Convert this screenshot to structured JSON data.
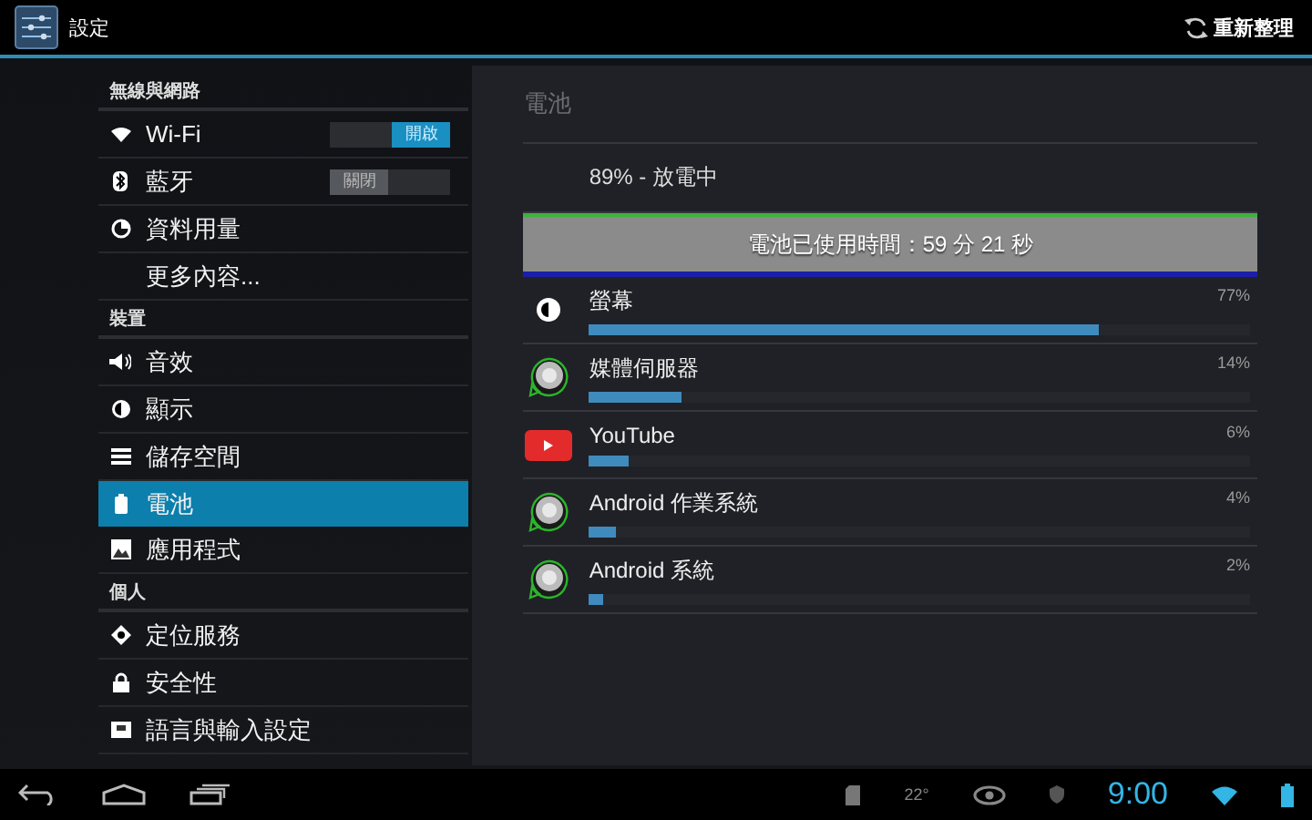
{
  "action_bar": {
    "title": "設定",
    "refresh": "重新整理"
  },
  "sidebar": {
    "sections": [
      {
        "header": "無線與網路",
        "items": [
          {
            "label": "Wi-Fi",
            "selected": false,
            "switch": {
              "label": "開啟",
              "on": true
            }
          },
          {
            "label": "藍牙",
            "selected": false,
            "switch": {
              "label": "關閉",
              "on": false
            }
          },
          {
            "label": "資料用量",
            "selected": false
          },
          {
            "label": "更多內容...",
            "selected": false
          }
        ]
      },
      {
        "header": "裝置",
        "items": [
          {
            "label": "音效",
            "selected": false
          },
          {
            "label": "顯示",
            "selected": false
          },
          {
            "label": "儲存空間",
            "selected": false
          },
          {
            "label": "電池",
            "selected": true
          },
          {
            "label": "應用程式",
            "selected": false
          }
        ]
      },
      {
        "header": "個人",
        "items": [
          {
            "label": "定位服務",
            "selected": false
          },
          {
            "label": "安全性",
            "selected": false
          },
          {
            "label": "語言與輸入設定",
            "selected": false
          }
        ]
      }
    ]
  },
  "detail": {
    "title": "電池",
    "status": "89% - 放電中",
    "graph_label": "電池已使用時間：59 分 21 秒",
    "usage": [
      {
        "name": "螢幕",
        "percent": "77%",
        "level": 0.77
      },
      {
        "name": "媒體伺服器",
        "percent": "14%",
        "level": 0.14
      },
      {
        "name": "YouTube",
        "percent": "6%",
        "level": 0.06
      },
      {
        "name": "Android 作業系統",
        "percent": "4%",
        "level": 0.04
      },
      {
        "name": "Android 系統",
        "percent": "2%",
        "level": 0.02
      }
    ]
  },
  "status_bar": {
    "temperature": "22°",
    "time": "9:00"
  }
}
